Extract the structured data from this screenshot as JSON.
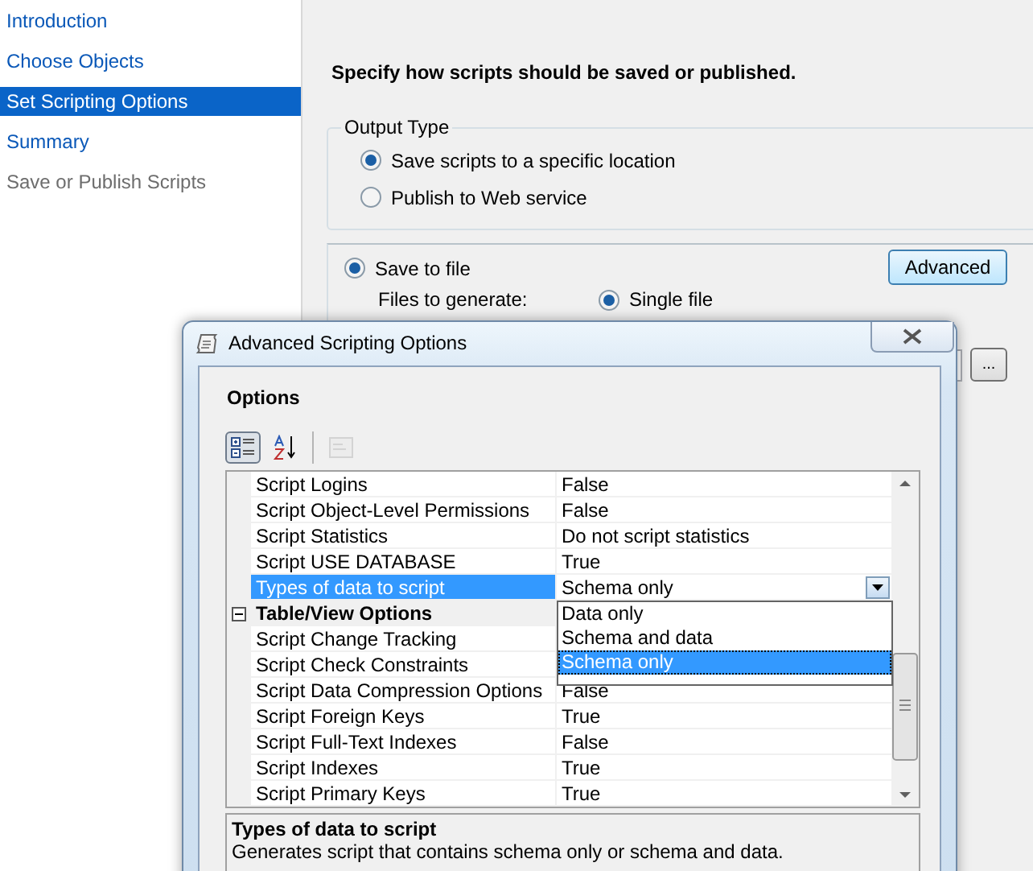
{
  "sidebar": {
    "items": [
      {
        "label": "Introduction",
        "selected": false,
        "disabled": false
      },
      {
        "label": "Choose Objects",
        "selected": false,
        "disabled": false
      },
      {
        "label": "Set Scripting Options",
        "selected": true,
        "disabled": false
      },
      {
        "label": "Summary",
        "selected": false,
        "disabled": false
      },
      {
        "label": "Save or Publish Scripts",
        "selected": false,
        "disabled": true
      }
    ]
  },
  "main": {
    "heading": "Specify how scripts should be saved or published.",
    "output_type": {
      "title": "Output Type",
      "options": [
        {
          "label": "Save scripts to a specific location",
          "selected": true
        },
        {
          "label": "Publish to Web service",
          "selected": false
        }
      ]
    },
    "save_panel": {
      "save_to_file": {
        "label": "Save to file",
        "selected": true
      },
      "advanced_button": "Advanced",
      "files_label": "Files to generate:",
      "file_options": [
        {
          "label": "Single file",
          "selected": true
        }
      ],
      "browse_button": "..."
    }
  },
  "dialog": {
    "title": "Advanced Scripting Options",
    "section": "Options",
    "toolbar": [
      {
        "kind": "categorized",
        "selected": true,
        "disabled": false
      },
      {
        "kind": "alphabetical",
        "selected": false,
        "disabled": false
      },
      {
        "kind": "property-pages",
        "selected": false,
        "disabled": true
      }
    ],
    "rows": [
      {
        "kind": "property",
        "name": "Script Logins",
        "value": "False",
        "selected": false
      },
      {
        "kind": "property",
        "name": "Script Object-Level Permissions",
        "value": "False",
        "selected": false
      },
      {
        "kind": "property",
        "name": "Script Statistics",
        "value": "Do not script statistics",
        "selected": false
      },
      {
        "kind": "property",
        "name": "Script USE DATABASE",
        "value": "True",
        "selected": false
      },
      {
        "kind": "property",
        "name": "Types of data to script",
        "value": "Schema only",
        "selected": true,
        "dropdown": [
          {
            "label": "Data only",
            "selected": false
          },
          {
            "label": "Schema and data",
            "selected": false
          },
          {
            "label": "Schema only",
            "selected": true
          }
        ]
      },
      {
        "kind": "category",
        "name": "Table/View Options",
        "expanded": true
      },
      {
        "kind": "property",
        "name": "Script Change Tracking",
        "selected": false
      },
      {
        "kind": "property",
        "name": "Script Check Constraints",
        "selected": false
      },
      {
        "kind": "property",
        "name": "Script Data Compression Options",
        "value": "False",
        "selected": false
      },
      {
        "kind": "property",
        "name": "Script Foreign Keys",
        "value": "True",
        "selected": false
      },
      {
        "kind": "property",
        "name": "Script Full-Text Indexes",
        "value": "False",
        "selected": false
      },
      {
        "kind": "property",
        "name": "Script Indexes",
        "value": "True",
        "selected": false
      },
      {
        "kind": "property",
        "name": "Script Primary Keys",
        "value": "True",
        "selected": false
      }
    ],
    "description": {
      "title": "Types of data to script",
      "text": "Generates script that contains schema only or schema and data."
    }
  }
}
